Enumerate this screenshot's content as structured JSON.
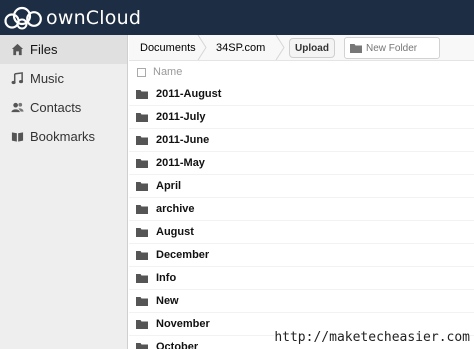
{
  "brand": {
    "name": "ownCloud"
  },
  "sidebar": {
    "items": [
      {
        "label": "Files",
        "icon": "home-icon",
        "active": true
      },
      {
        "label": "Music",
        "icon": "music-icon",
        "active": false
      },
      {
        "label": "Contacts",
        "icon": "contacts-icon",
        "active": false
      },
      {
        "label": "Bookmarks",
        "icon": "book-icon",
        "active": false
      }
    ]
  },
  "breadcrumb": {
    "root": "Documents",
    "current": "34SP.com"
  },
  "toolbar": {
    "upload_label": "Upload",
    "new_folder_placeholder": "New Folder"
  },
  "file_list": {
    "name_header": "Name",
    "folders": [
      "2011-August",
      "2011-July",
      "2011-June",
      "2011-May",
      "April",
      "archive",
      "August",
      "December",
      "Info",
      "New",
      "November",
      "October"
    ]
  },
  "watermark": "http://maketecheasier.com",
  "colors": {
    "header_bg": "#1d2d44",
    "sidebar_bg": "#eeeeee",
    "folder_icon": "#555555"
  }
}
